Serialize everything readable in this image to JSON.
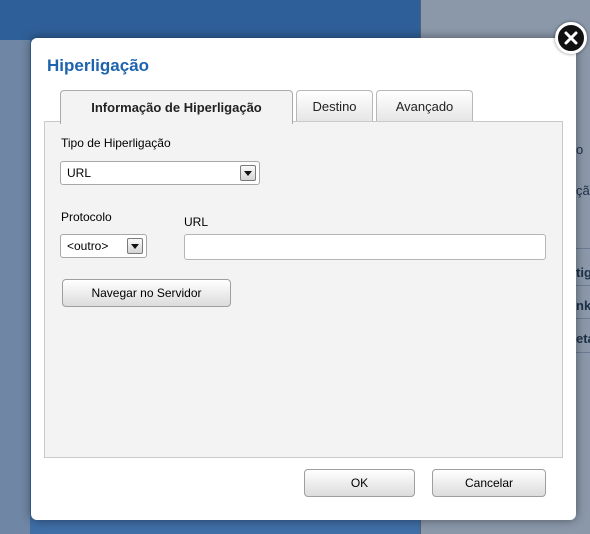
{
  "dialog": {
    "title": "Hiperligação",
    "close_icon": "close-icon"
  },
  "tabs": [
    {
      "label": "Informação de Hiperligação",
      "active": true
    },
    {
      "label": "Destino",
      "active": false
    },
    {
      "label": "Avançado",
      "active": false
    }
  ],
  "form": {
    "link_type_label": "Tipo de Hiperligação",
    "link_type_value": "URL",
    "protocol_label": "Protocolo",
    "protocol_value": "<outro>",
    "url_label": "URL",
    "url_value": "",
    "browse_server_label": "Navegar no Servidor"
  },
  "footer": {
    "ok_label": "OK",
    "cancel_label": "Cancelar"
  },
  "background": {
    "snippets": [
      "o",
      "çã",
      "tig",
      "nk",
      "eta"
    ]
  },
  "colors": {
    "title": "#1d63ad",
    "backdrop": "#3f6ea6"
  }
}
